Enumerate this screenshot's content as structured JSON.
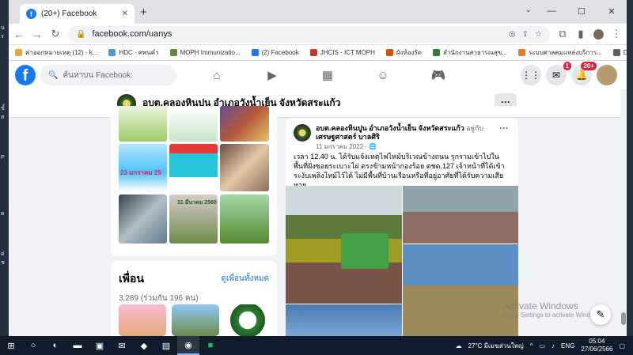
{
  "browser": {
    "tab_title": "(20+) Facebook",
    "url": "facebook.com/uanys",
    "bookmarks": [
      {
        "label": "ค่าออกหมายเหตุ (12) - k...",
        "color": "#e8a33c"
      },
      {
        "label": "HDC - ศพนคำ",
        "color": "#3aa0d8"
      },
      {
        "label": "MOPH Immunizatio...",
        "color": "#5b8c3a"
      },
      {
        "label": "(2) Facebook",
        "color": "#1877f2"
      },
      {
        "label": "JHCIS - ICT MOPH",
        "color": "#c0392b"
      },
      {
        "label": "ผังห้องรัด",
        "color": "#d35400"
      },
      {
        "label": "สำนักงานสาธารณสุข...",
        "color": "#2e7d32"
      },
      {
        "label": "ระบบศาลคมแหล่งบริการ...",
        "color": "#e67e22"
      },
      {
        "label": "DLA_WASTE : INFO...",
        "color": "#616161"
      }
    ]
  },
  "fb": {
    "search_placeholder": "ค้นหาบน Facebook:",
    "messenger_badge": "1",
    "notif_badge": "20+"
  },
  "page": {
    "name": "อบต.คลองหินปูน อำเภอวังน้ำเย็น จังหวัดสระแก้ว"
  },
  "photos": {
    "text1": "23 มกราคม 25",
    "text2": "31 มีนาคม 2565"
  },
  "friends": {
    "title": "เพื่อน",
    "see_all": "ดูเพื่อนทั้งหมด",
    "count": "3,289 (ร่วมกัน 196 คน)"
  },
  "post": {
    "author": "อบต.คลองหินปูน อำเภอวังน้ำเย็น จังหวัดสระแก้ว",
    "with": "อยู่กับ",
    "tagged": "เศรษฐศาสตร์ บาลศิริ",
    "time": "11 มกราคม 2022 · ",
    "text": "เวลา 12.40 น. ได้รับแจ้งเหตุไฟไหม้บริเวณข้างถนน รุกรามเข้าไปในพื้นที่ฝั่งซอยระเบาะไผ่ ตรงข้ามหน้ากองร้อย ตชด.127 เจ้าหน้าที่ได้เข้าระงับเพลิงไหม้ไว้ได้ ไม่มีพื้นที่บ้านเรือนหรือที่อยู่อาศัยที่ได้รับความเสียหาย"
  },
  "watermark": {
    "line1": "Activate Windows",
    "line2": "Go to Settings to activate Windows."
  },
  "taskbar": {
    "weather": "27°C มีเมฆส่วนใหญ่",
    "lang": "ENG",
    "time": "05:04",
    "date": "27/06/2566"
  }
}
